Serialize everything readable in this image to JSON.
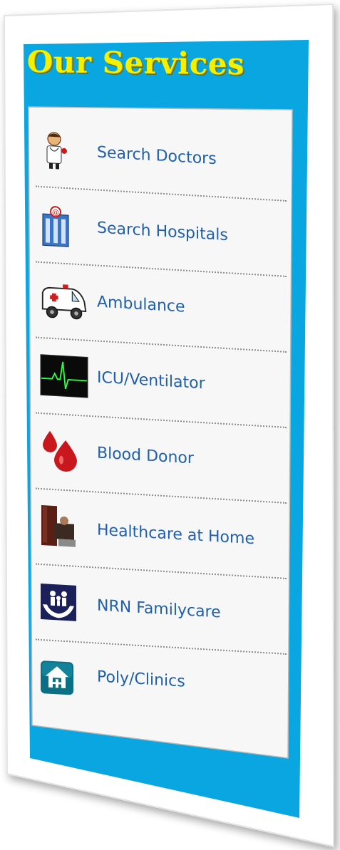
{
  "panel": {
    "title": "Our Services",
    "colors": {
      "panel_blue": "#0aa6e2",
      "title_yellow": "#f5f000",
      "link_blue": "#1f5fad",
      "list_bg": "#f7f7f7"
    }
  },
  "services": [
    {
      "label": "Search Doctors",
      "icon": "doctor-icon"
    },
    {
      "label": "Search Hospitals",
      "icon": "hospital-icon"
    },
    {
      "label": "Ambulance",
      "icon": "ambulance-icon"
    },
    {
      "label": "ICU/Ventilator",
      "icon": "heart-monitor-icon"
    },
    {
      "label": "Blood Donor",
      "icon": "blood-drop-icon"
    },
    {
      "label": "Healthcare at Home",
      "icon": "home-care-icon"
    },
    {
      "label": "NRN Familycare",
      "icon": "family-care-icon"
    },
    {
      "label": "Poly/Clinics",
      "icon": "clinic-house-icon"
    }
  ]
}
